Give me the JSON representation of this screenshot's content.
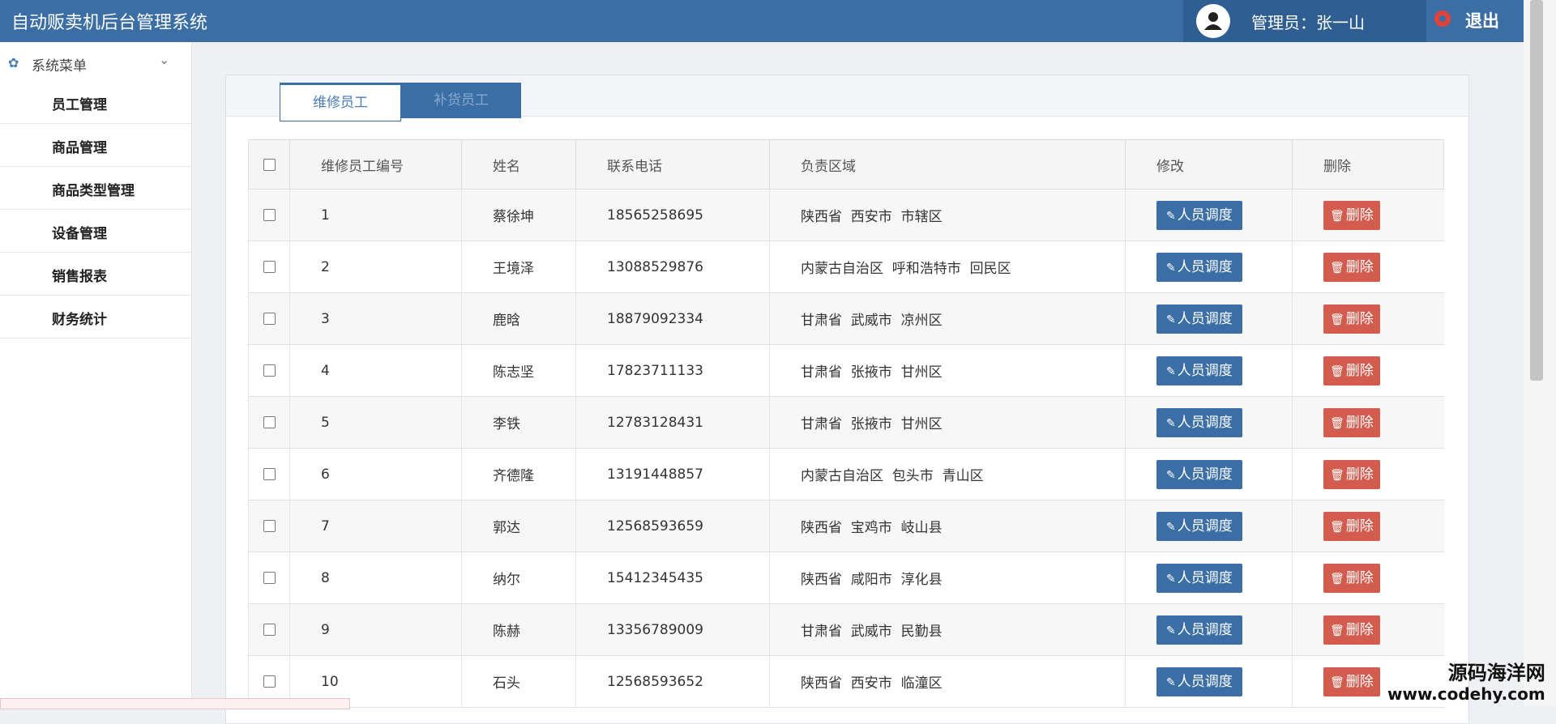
{
  "header": {
    "app_title": "自动贩卖机后台管理系统",
    "admin_label": "管理员：张一山",
    "logout_label": "退出"
  },
  "sidebar": {
    "menu_title": "系统菜单",
    "items": [
      {
        "label": "员工管理"
      },
      {
        "label": "商品管理"
      },
      {
        "label": "商品类型管理"
      },
      {
        "label": "设备管理"
      },
      {
        "label": "销售报表"
      },
      {
        "label": "财务统计"
      }
    ]
  },
  "tabs": [
    {
      "label": "维修员工",
      "active": true
    },
    {
      "label": "补货员工",
      "active": false
    }
  ],
  "table": {
    "headers": [
      "维修员工编号",
      "姓名",
      "联系电话",
      "负责区域",
      "修改",
      "删除"
    ],
    "edit_label": "人员调度",
    "delete_label": "删除",
    "rows": [
      {
        "id": "1",
        "name": "蔡徐坤",
        "phone": "18565258695",
        "area": "陕西省  西安市  市辖区"
      },
      {
        "id": "2",
        "name": "王境泽",
        "phone": "13088529876",
        "area": "内蒙古自治区  呼和浩特市  回民区"
      },
      {
        "id": "3",
        "name": "鹿晗",
        "phone": "18879092334",
        "area": "甘肃省  武威市  凉州区"
      },
      {
        "id": "4",
        "name": "陈志坚",
        "phone": "17823711133",
        "area": "甘肃省  张掖市  甘州区"
      },
      {
        "id": "5",
        "name": "李铁",
        "phone": "12783128431",
        "area": "甘肃省  张掖市  甘州区"
      },
      {
        "id": "6",
        "name": "齐德隆",
        "phone": "13191448857",
        "area": "内蒙古自治区  包头市  青山区"
      },
      {
        "id": "7",
        "name": "郭达",
        "phone": "12568593659",
        "area": "陕西省  宝鸡市  岐山县"
      },
      {
        "id": "8",
        "name": "纳尔",
        "phone": "15412345435",
        "area": "陕西省  咸阳市  淳化县"
      },
      {
        "id": "9",
        "name": "陈赫",
        "phone": "13356789009",
        "area": "甘肃省  武威市  民勤县"
      },
      {
        "id": "10",
        "name": "石头",
        "phone": "12568593652",
        "area": "陕西省  西安市  临潼区"
      }
    ]
  },
  "watermark": {
    "line1": "源码海洋网",
    "line2": "www.codehy.com"
  },
  "colors": {
    "primary": "#3a6ea5",
    "danger": "#d35c4e",
    "header_dark": "#2f5f92"
  }
}
